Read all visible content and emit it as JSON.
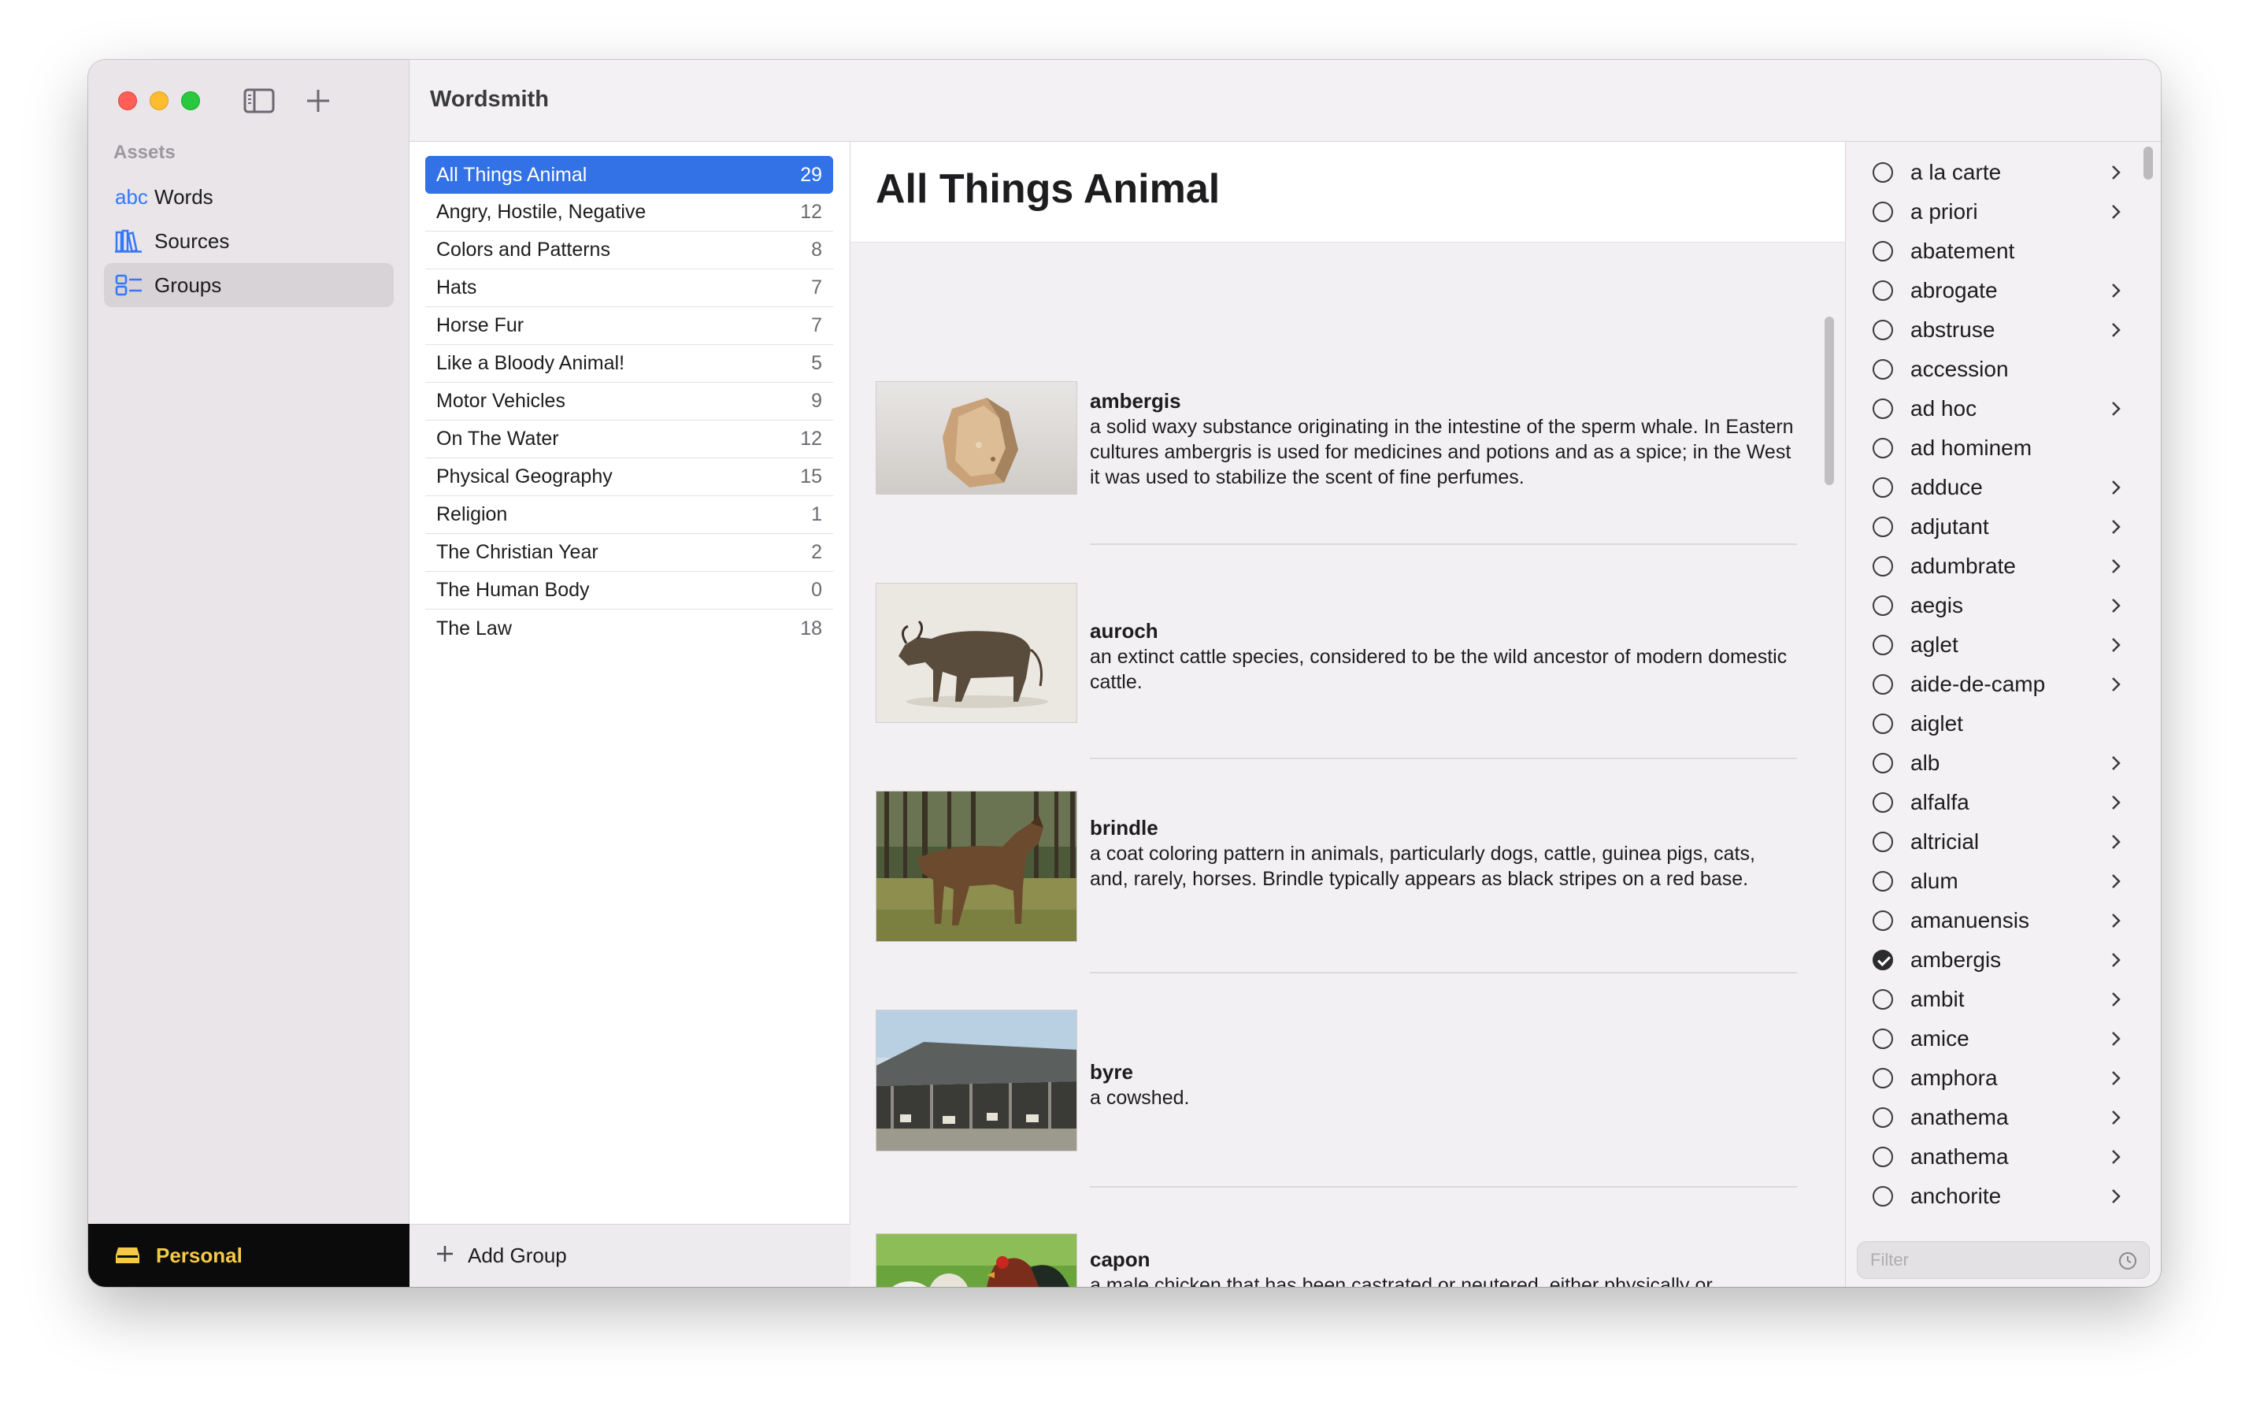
{
  "app": {
    "title": "Wordsmith"
  },
  "sidebar": {
    "section_label": "Assets",
    "items": [
      {
        "label": "Words",
        "icon": "abc-icon",
        "selected": false
      },
      {
        "label": "Sources",
        "icon": "books-icon",
        "selected": false
      },
      {
        "label": "Groups",
        "icon": "groups-icon",
        "selected": true
      }
    ],
    "account_label": "Personal",
    "account_icon": "drawer-icon"
  },
  "groups": {
    "items": [
      {
        "label": "All Things Animal",
        "count": "29",
        "selected": true
      },
      {
        "label": "Angry, Hostile, Negative",
        "count": "12"
      },
      {
        "label": "Colors and Patterns",
        "count": "8"
      },
      {
        "label": "Hats",
        "count": "7"
      },
      {
        "label": "Horse Fur",
        "count": "7"
      },
      {
        "label": "Like a Bloody Animal!",
        "count": "5"
      },
      {
        "label": "Motor Vehicles",
        "count": "9"
      },
      {
        "label": "On The Water",
        "count": "12"
      },
      {
        "label": "Physical Geography",
        "count": "15"
      },
      {
        "label": "Religion",
        "count": "1"
      },
      {
        "label": "The Christian Year",
        "count": "2"
      },
      {
        "label": "The Human Body",
        "count": "0"
      },
      {
        "label": "The Law",
        "count": "18"
      }
    ],
    "add_label": "Add Group"
  },
  "detail": {
    "title": "All Things Animal",
    "entries": [
      {
        "word": "ambergis",
        "definition": "a solid waxy substance originating in the intestine of the sperm whale. In Eastern cultures ambergris is used for medicines and potions and as a spice; in the West it was used to stabilize the scent of fine perfumes."
      },
      {
        "word": "auroch",
        "definition": "an extinct cattle species, considered to be the wild ancestor of modern domestic cattle."
      },
      {
        "word": "brindle",
        "definition": "a coat coloring pattern in animals, particularly dogs, cattle, guinea pigs, cats, and, rarely, horses. Brindle typically appears as black stripes on a red base."
      },
      {
        "word": "byre",
        "definition": "a cowshed."
      },
      {
        "word": "capon",
        "definition": "a male chicken that has been castrated or neutered, either physically or chemically, to improve the quality of its flesh for food, and, in some countries fattened by forced feeding."
      }
    ]
  },
  "wordlist": {
    "items": [
      {
        "label": "a la carte",
        "chevron": true,
        "checked": false
      },
      {
        "label": "a priori",
        "chevron": true,
        "checked": false
      },
      {
        "label": "abatement",
        "chevron": false,
        "checked": false
      },
      {
        "label": "abrogate",
        "chevron": true,
        "checked": false
      },
      {
        "label": "abstruse",
        "chevron": true,
        "checked": false
      },
      {
        "label": "accession",
        "chevron": false,
        "checked": false
      },
      {
        "label": "ad hoc",
        "chevron": true,
        "checked": false
      },
      {
        "label": "ad hominem",
        "chevron": false,
        "checked": false
      },
      {
        "label": "adduce",
        "chevron": true,
        "checked": false
      },
      {
        "label": "adjutant",
        "chevron": true,
        "checked": false
      },
      {
        "label": "adumbrate",
        "chevron": true,
        "checked": false
      },
      {
        "label": "aegis",
        "chevron": true,
        "checked": false
      },
      {
        "label": "aglet",
        "chevron": true,
        "checked": false
      },
      {
        "label": "aide-de-camp",
        "chevron": true,
        "checked": false
      },
      {
        "label": "aiglet",
        "chevron": false,
        "checked": false
      },
      {
        "label": "alb",
        "chevron": true,
        "checked": false
      },
      {
        "label": "alfalfa",
        "chevron": true,
        "checked": false
      },
      {
        "label": "altricial",
        "chevron": true,
        "checked": false
      },
      {
        "label": "alum",
        "chevron": true,
        "checked": false
      },
      {
        "label": "amanuensis",
        "chevron": true,
        "checked": false
      },
      {
        "label": "ambergis",
        "chevron": true,
        "checked": true
      },
      {
        "label": "ambit",
        "chevron": true,
        "checked": false
      },
      {
        "label": "amice",
        "chevron": true,
        "checked": false
      },
      {
        "label": "amphora",
        "chevron": true,
        "checked": false
      },
      {
        "label": "anathema",
        "chevron": true,
        "checked": false
      },
      {
        "label": "anathema",
        "chevron": true,
        "checked": false
      },
      {
        "label": "anchorite",
        "chevron": true,
        "checked": false
      }
    ],
    "filter_placeholder": "Filter",
    "filter_icon": "clock-icon"
  },
  "colors": {
    "accent": "#3271e6",
    "sidebar_icon": "#3478f6",
    "personal_text": "#f6c945"
  }
}
